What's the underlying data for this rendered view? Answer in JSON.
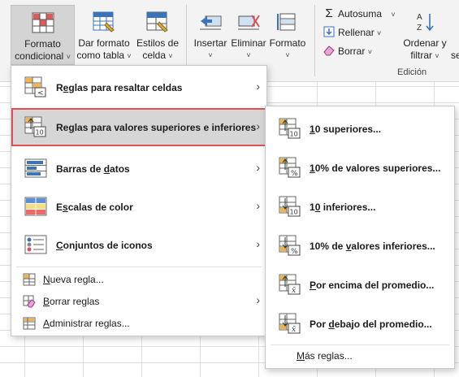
{
  "ribbon": {
    "formato_condicional": {
      "line1": "Formato",
      "line2": "condicional",
      "caret": "˅"
    },
    "dar_formato": {
      "line1": "Dar formato",
      "line2": "como tabla",
      "caret": "˅"
    },
    "estilos_celda": {
      "line1": "Estilos de",
      "line2": "celda",
      "caret": "˅"
    },
    "insertar": {
      "label": "Insertar",
      "caret": "˅"
    },
    "eliminar": {
      "label": "Eliminar",
      "caret": "˅"
    },
    "formato": {
      "label": "Formato",
      "caret": "˅"
    },
    "autosuma": {
      "label": "Autosuma",
      "caret": "˅"
    },
    "rellenar": {
      "label": "Rellenar",
      "caret": "˅"
    },
    "borrar": {
      "label": "Borrar",
      "caret": "˅"
    },
    "ordenar": {
      "line1": "Ordenar y",
      "line2": "filtrar",
      "caret": "˅"
    },
    "cut_label": "se",
    "group_label": "Edición",
    "autosuma_symbol": "Σ"
  },
  "menu1": {
    "items": [
      {
        "pre": "R",
        "u": "e",
        "post": "glas para resaltar celdas"
      },
      {
        "pre": "Re",
        "u": "g",
        "post": "las para valores superiores e inferiores"
      },
      {
        "pre": "Barras de ",
        "u": "d",
        "post": "atos"
      },
      {
        "pre": "E",
        "u": "s",
        "post": "calas de color"
      },
      {
        "pre": "",
        "u": "C",
        "post": "onjuntos de iconos"
      }
    ],
    "small": [
      {
        "pre": "",
        "u": "N",
        "post": "ueva regla..."
      },
      {
        "pre": "",
        "u": "B",
        "post": "orrar reglas"
      },
      {
        "pre": "",
        "u": "A",
        "post": "dministrar reglas..."
      }
    ],
    "arrow": "›"
  },
  "menu2": {
    "items": [
      {
        "pre": "",
        "u": "1",
        "post": "0 superiores..."
      },
      {
        "pre": "",
        "u": "1",
        "post": "0% de valores superiores..."
      },
      {
        "pre": "1",
        "u": "0",
        "post": " inferiores..."
      },
      {
        "pre": "10% de ",
        "u": "v",
        "post": "alores inferiores..."
      },
      {
        "pre": "",
        "u": "P",
        "post": "or encima del promedio..."
      },
      {
        "pre": "Por ",
        "u": "d",
        "post": "ebajo del promedio..."
      }
    ],
    "icon_texts": [
      "10",
      "%",
      "10",
      "%",
      "x̄",
      "x̄"
    ],
    "more": {
      "pre": "",
      "u": "M",
      "post": "ás reglas..."
    }
  },
  "colors": {
    "accent_red": "#e04f56",
    "excel_green": "#217346",
    "icon_blue": "#3b73b9"
  }
}
